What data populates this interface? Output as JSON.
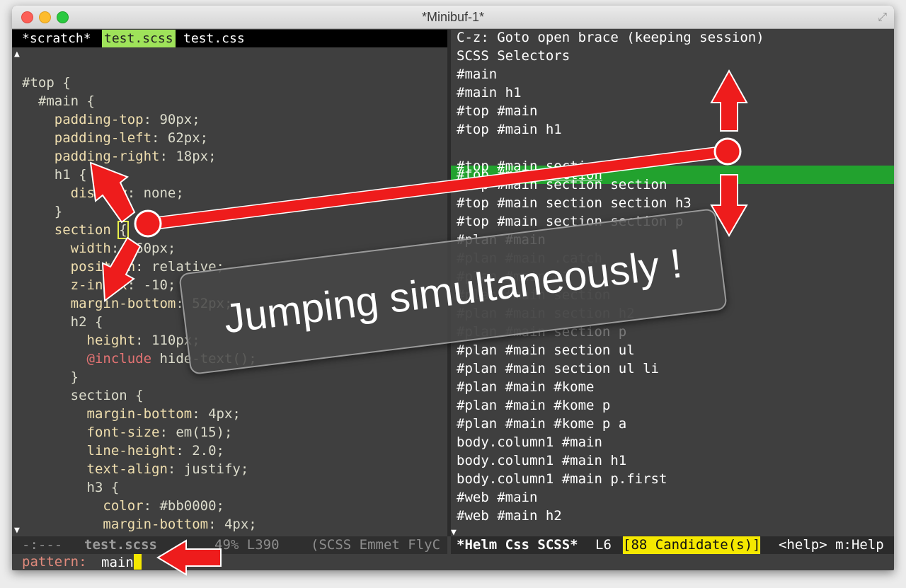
{
  "window": {
    "title": "*Minibuf-1*",
    "fullscreen_icon": "expand-arrows-icon"
  },
  "left_pane": {
    "tabs": [
      {
        "label": "*scratch*",
        "active": false
      },
      {
        "label": "test.scss",
        "active": true
      },
      {
        "label": "test.css",
        "active": false
      }
    ],
    "code": [
      {
        "p": "#top {",
        "v": ""
      },
      {
        "p": "  #main {",
        "v": ""
      },
      {
        "p": "    padding-top",
        "v": ": 90px;"
      },
      {
        "p": "    padding-left",
        "v": ": 62px;"
      },
      {
        "p": "    padding-right",
        "v": ": 18px;"
      },
      {
        "p": "    h1 {",
        "v": ""
      },
      {
        "p": "      display",
        "v": ": none;"
      },
      {
        "p": "    }",
        "v": ""
      },
      {
        "p": "    section ",
        "v": "{",
        "brace": true
      },
      {
        "p": "      width",
        "v": ": 660px;"
      },
      {
        "p": "      position",
        "v": ": relative;"
      },
      {
        "p": "      z-index",
        "v": ": -10;"
      },
      {
        "p": "      margin-bottom",
        "v": ": 52px;"
      },
      {
        "p": "      h2 {",
        "v": ""
      },
      {
        "p": "        height",
        "v": ": 110px;"
      },
      {
        "p": "        ",
        "v": " hide-text();",
        "at": "@include"
      },
      {
        "p": "      }",
        "v": ""
      },
      {
        "p": "      section {",
        "v": ""
      },
      {
        "p": "        margin-bottom",
        "v": ": 4px;"
      },
      {
        "p": "        font-size",
        "v": ": em(15);"
      },
      {
        "p": "        line-height",
        "v": ": 2.0;"
      },
      {
        "p": "        text-align",
        "v": ": justify;"
      },
      {
        "p": "        h3 {",
        "v": ""
      },
      {
        "p": "          color",
        "v": ": #bb0000;"
      },
      {
        "p": "          margin-bottom",
        "v": ": 4px;"
      }
    ],
    "modeline": {
      "status": "-:---",
      "buffer": "test.scss",
      "position": "49% L390",
      "modes": "(SCSS Emmet FlyC"
    }
  },
  "right_pane": {
    "header": "C-z: Goto open brace (keeping session)",
    "section_title": "SCSS Selectors",
    "candidates": [
      {
        "text": "#main",
        "dim": false
      },
      {
        "text": "#main h1",
        "dim": false
      },
      {
        "text": "#top #main",
        "dim": false
      },
      {
        "text": "#top #main h1",
        "dim": false
      },
      {
        "text": "#top #main section",
        "dim": false,
        "selected": true
      },
      {
        "text": "#top #main section h2",
        "dim": false
      },
      {
        "text": "#top #main section section",
        "dim": false
      },
      {
        "text": "#top #main section section h3",
        "dim": false
      },
      {
        "text": "#top #main section section p",
        "dim": false
      },
      {
        "text": "#plan #main",
        "dim": false
      },
      {
        "text": "#plan #main .catch",
        "dim": true
      },
      {
        "text": "#plan #main h1",
        "dim": true
      },
      {
        "text": "#plan #main section",
        "dim": true
      },
      {
        "text": "#plan #main section h2",
        "dim": true
      },
      {
        "text": "#plan #main section p",
        "dim": true
      },
      {
        "text": "#plan #main section ul",
        "dim": false
      },
      {
        "text": "#plan #main section ul li",
        "dim": false
      },
      {
        "text": "#plan #main #kome",
        "dim": false
      },
      {
        "text": "#plan #main #kome p",
        "dim": false
      },
      {
        "text": "#plan #main #kome p a",
        "dim": false
      },
      {
        "text": "body.column1 #main",
        "dim": false
      },
      {
        "text": "body.column1 #main h1",
        "dim": false
      },
      {
        "text": "body.column1 #main p.first",
        "dim": false
      },
      {
        "text": "#web #main",
        "dim": false
      },
      {
        "text": "#web #main h2",
        "dim": false
      }
    ],
    "modeline": {
      "buffer": "*Helm Css SCSS*",
      "line": "L6",
      "candidates": "[88 Candidate(s)]",
      "help": "<help> m:Help"
    }
  },
  "minibuffer": {
    "prompt": "pattern:",
    "value": "main"
  },
  "annotation": {
    "banner_text": "Jumping simultaneously !"
  },
  "colors": {
    "background": "#3f3f3f",
    "selection": "#22a22e",
    "active_tab": "#9fe35a",
    "arrow": "#ee1c1c",
    "candidate_badge": "#f5e800"
  }
}
